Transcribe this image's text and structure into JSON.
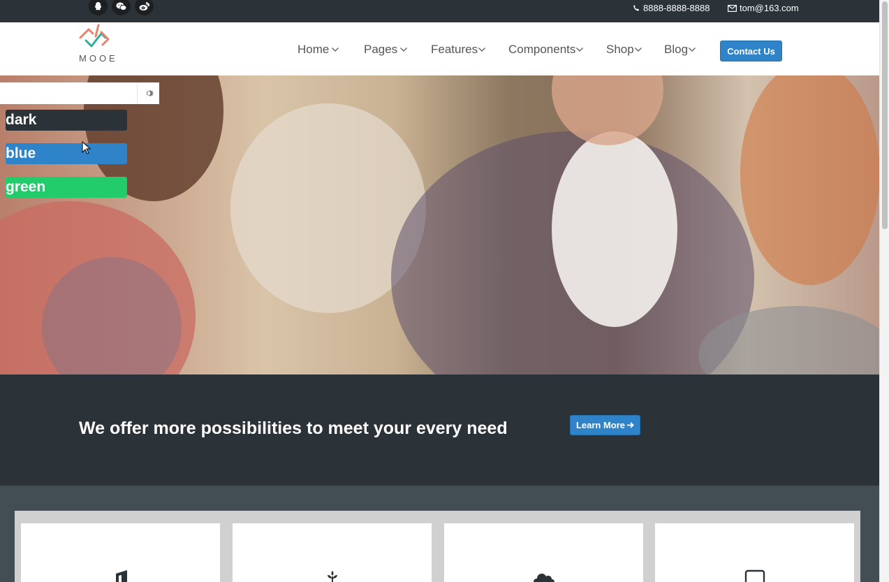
{
  "topbar": {
    "phone": "8888-8888-8888",
    "email": "tom@163.com",
    "social_icons": [
      "qq-icon",
      "wechat-icon",
      "weibo-icon"
    ]
  },
  "brand": {
    "logo_text": "MOOE"
  },
  "nav": {
    "items": [
      {
        "label": "Home"
      },
      {
        "label": "Pages"
      },
      {
        "label": "Features"
      },
      {
        "label": "Components"
      },
      {
        "label": "Shop"
      },
      {
        "label": "Blog"
      }
    ],
    "contact_button": "Contact Us"
  },
  "theme_switcher": {
    "options": [
      {
        "label": "dark",
        "color": "#2c3338"
      },
      {
        "label": "blue",
        "color": "#2f83c9"
      },
      {
        "label": "green",
        "color": "#22cc6a"
      }
    ]
  },
  "banner": {
    "title": "We offer more possibilities to meet your every need",
    "button": "Learn More"
  },
  "features": {
    "cards": [
      {
        "icon": "music-icon"
      },
      {
        "icon": "leaf-icon"
      },
      {
        "icon": "cloud-icon"
      },
      {
        "icon": "monitor-icon"
      }
    ]
  },
  "colors": {
    "dark": "#2c3338",
    "accent": "#2f83c9",
    "features_bg": "#434e54"
  }
}
